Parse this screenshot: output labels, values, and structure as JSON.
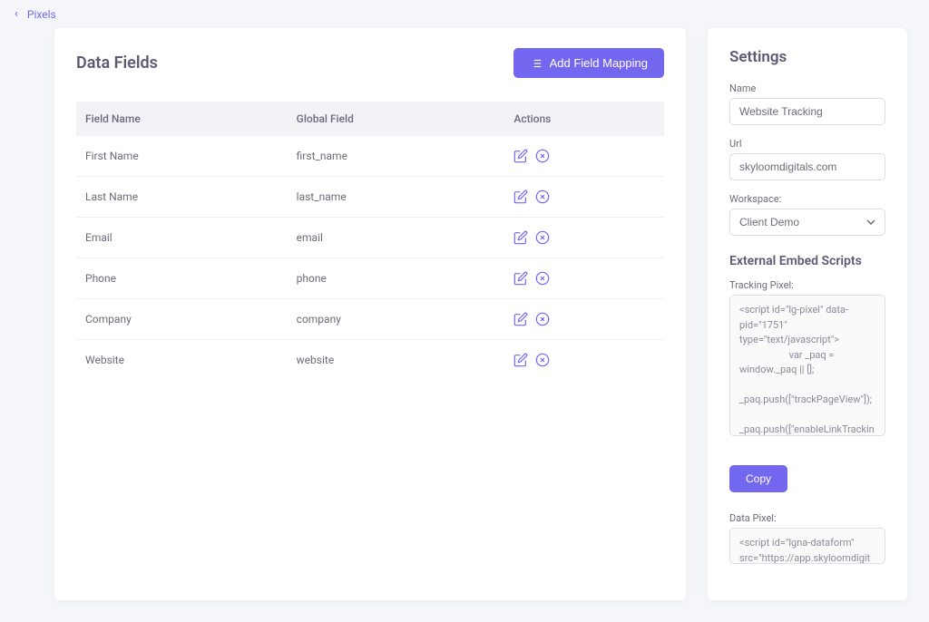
{
  "breadcrumb": {
    "back_icon": "‹",
    "label": "Pixels"
  },
  "dataFields": {
    "title": "Data Fields",
    "addButton": "Add Field Mapping",
    "columns": [
      "Field Name",
      "Global Field",
      "Actions"
    ],
    "rows": [
      {
        "name": "First Name",
        "global": "first_name"
      },
      {
        "name": "Last Name",
        "global": "last_name"
      },
      {
        "name": "Email",
        "global": "email"
      },
      {
        "name": "Phone",
        "global": "phone"
      },
      {
        "name": "Company",
        "global": "company"
      },
      {
        "name": "Website",
        "global": "website"
      }
    ]
  },
  "settings": {
    "title": "Settings",
    "nameLabel": "Name",
    "nameValue": "Website Tracking",
    "urlLabel": "Url",
    "urlValue": "skyloomdigitals.com",
    "workspaceLabel": "Workspace:",
    "workspaceValue": "Client Demo",
    "embedTitle": "External Embed Scripts",
    "trackingPixelLabel": "Tracking Pixel:",
    "trackingPixelCode": "<script id=\"lg-pixel\" data-pid=\"1751\" type=\"text/javascript\">\n                    var _paq = window._paq || [];\n                _paq.push([\"trackPageView\"]);\n                _paq.push([\"enableLinkTracking\"]);",
    "copyLabel": "Copy",
    "dataPixelLabel": "Data Pixel:",
    "dataPixelCode": "<script id=\"lgna-dataform\" src=\"https://app.skyloomdigitals"
  }
}
